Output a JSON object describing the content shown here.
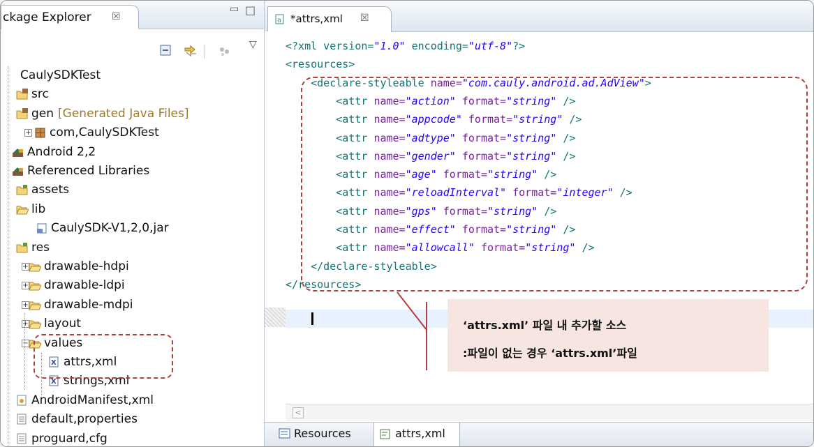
{
  "package_explorer": {
    "tab_label": "ckage Explorer",
    "close_glyph": "☒",
    "minimize_glyph": "▭",
    "maximize_glyph": "□",
    "view_menu_glyph": "▽",
    "tree": [
      {
        "label": "CaulySDKTest",
        "icon": "project-icon"
      },
      {
        "label": "src",
        "icon": "source-folder-icon"
      },
      {
        "label": "gen",
        "suffix": "[Generated Java Files]",
        "icon": "generated-folder-icon"
      },
      {
        "label": "com,CaulySDKTest",
        "icon": "package-icon"
      },
      {
        "label": "Android 2,2",
        "icon": "library-icon"
      },
      {
        "label": "Referenced Libraries",
        "icon": "library-icon"
      },
      {
        "label": "assets",
        "icon": "folder-icon"
      },
      {
        "label": "lib",
        "icon": "folder-open-icon"
      },
      {
        "label": "CaulySDK-V1,2,0,jar",
        "icon": "jar-icon"
      },
      {
        "label": "res",
        "icon": "folder-icon"
      },
      {
        "label": "drawable-hdpi",
        "icon": "folder-open-icon"
      },
      {
        "label": "drawable-ldpi",
        "icon": "folder-open-icon"
      },
      {
        "label": "drawable-mdpi",
        "icon": "folder-open-icon"
      },
      {
        "label": "layout",
        "icon": "folder-open-icon"
      },
      {
        "label": "values",
        "icon": "folder-open-icon"
      },
      {
        "label": "attrs,xml",
        "icon": "xml-file-icon"
      },
      {
        "label": "strings,xml",
        "icon": "xml-file-icon"
      },
      {
        "label": "AndroidManifest,xml",
        "icon": "manifest-icon"
      },
      {
        "label": "default,properties",
        "icon": "text-file-icon"
      },
      {
        "label": "proguard,cfg",
        "icon": "text-file-icon"
      }
    ]
  },
  "editor": {
    "tab_label": "*attrs,xml",
    "close_glyph": "☒",
    "lines": [
      {
        "segments": [
          {
            "t": "<?xml version=",
            "c": "tag"
          },
          {
            "t": "\"1.0\"",
            "c": "attrval"
          },
          {
            "t": " encoding=",
            "c": "tag"
          },
          {
            "t": "\"utf-8\"",
            "c": "attrval"
          },
          {
            "t": "?>",
            "c": "tag"
          }
        ]
      },
      {
        "segments": [
          {
            "t": "<resources>",
            "c": "tag"
          }
        ]
      },
      {
        "segments": [
          {
            "t": "    <declare-styleable ",
            "c": "tag"
          },
          {
            "t": "name=",
            "c": "attrname"
          },
          {
            "t": "\"com.cauly.android.ad.AdView\"",
            "c": "attrval"
          },
          {
            "t": ">",
            "c": "tag"
          }
        ]
      },
      {
        "segments": [
          {
            "t": "        <attr ",
            "c": "tag"
          },
          {
            "t": "name=",
            "c": "attrname"
          },
          {
            "t": "\"action\"",
            "c": "attrval"
          },
          {
            "t": " format=",
            "c": "attrname"
          },
          {
            "t": "\"string\"",
            "c": "attrval"
          },
          {
            "t": " />",
            "c": "tag"
          }
        ]
      },
      {
        "segments": [
          {
            "t": "        <attr ",
            "c": "tag"
          },
          {
            "t": "name=",
            "c": "attrname"
          },
          {
            "t": "\"appcode\"",
            "c": "attrval"
          },
          {
            "t": " format=",
            "c": "attrname"
          },
          {
            "t": "\"string\"",
            "c": "attrval"
          },
          {
            "t": " />",
            "c": "tag"
          }
        ]
      },
      {
        "segments": [
          {
            "t": "        <attr ",
            "c": "tag"
          },
          {
            "t": "name=",
            "c": "attrname"
          },
          {
            "t": "\"adtype\"",
            "c": "attrval"
          },
          {
            "t": " format=",
            "c": "attrname"
          },
          {
            "t": "\"string\"",
            "c": "attrval"
          },
          {
            "t": " />",
            "c": "tag"
          }
        ]
      },
      {
        "segments": [
          {
            "t": "        <attr ",
            "c": "tag"
          },
          {
            "t": "name=",
            "c": "attrname"
          },
          {
            "t": "\"gender\"",
            "c": "attrval"
          },
          {
            "t": " format=",
            "c": "attrname"
          },
          {
            "t": "\"string\"",
            "c": "attrval"
          },
          {
            "t": " />",
            "c": "tag"
          }
        ]
      },
      {
        "segments": [
          {
            "t": "        <attr ",
            "c": "tag"
          },
          {
            "t": "name=",
            "c": "attrname"
          },
          {
            "t": "\"age\"",
            "c": "attrval"
          },
          {
            "t": " format=",
            "c": "attrname"
          },
          {
            "t": "\"string\"",
            "c": "attrval"
          },
          {
            "t": " />",
            "c": "tag"
          }
        ]
      },
      {
        "segments": [
          {
            "t": "        <attr ",
            "c": "tag"
          },
          {
            "t": "name=",
            "c": "attrname"
          },
          {
            "t": "\"reloadInterval\"",
            "c": "attrval"
          },
          {
            "t": " format=",
            "c": "attrname"
          },
          {
            "t": "\"integer\"",
            "c": "attrval"
          },
          {
            "t": " />",
            "c": "tag"
          }
        ]
      },
      {
        "segments": [
          {
            "t": "        <attr ",
            "c": "tag"
          },
          {
            "t": "name=",
            "c": "attrname"
          },
          {
            "t": "\"gps\"",
            "c": "attrval"
          },
          {
            "t": " format=",
            "c": "attrname"
          },
          {
            "t": "\"string\"",
            "c": "attrval"
          },
          {
            "t": " />",
            "c": "tag"
          }
        ]
      },
      {
        "segments": [
          {
            "t": "        <attr ",
            "c": "tag"
          },
          {
            "t": "name=",
            "c": "attrname"
          },
          {
            "t": "\"effect\"",
            "c": "attrval"
          },
          {
            "t": " format=",
            "c": "attrname"
          },
          {
            "t": "\"string\"",
            "c": "attrval"
          },
          {
            "t": " />",
            "c": "tag"
          }
        ]
      },
      {
        "segments": [
          {
            "t": "        <attr ",
            "c": "tag"
          },
          {
            "t": "name=",
            "c": "attrname"
          },
          {
            "t": "\"allowcall\"",
            "c": "attrval"
          },
          {
            "t": " format=",
            "c": "attrname"
          },
          {
            "t": "\"string\"",
            "c": "attrval"
          },
          {
            "t": " />",
            "c": "tag"
          }
        ]
      },
      {
        "segments": [
          {
            "t": "    </declare-styleable>",
            "c": "tag"
          }
        ]
      },
      {
        "segments": [
          {
            "t": "</resources>",
            "c": "tag"
          }
        ]
      }
    ]
  },
  "callout": {
    "line1": "‘attrs.xml’ 파일 내 추가할 소스",
    "line2": ":파일이 없는 경우 ‘attrs.xml’파일"
  },
  "bottom_tabs": {
    "resources": "Resources",
    "source": "attrs,xml"
  },
  "colors": {
    "highlight": "#b04040",
    "tag": "#127474",
    "attr_value": "#2a00ff",
    "callout_bg": "#f6e5e1"
  }
}
